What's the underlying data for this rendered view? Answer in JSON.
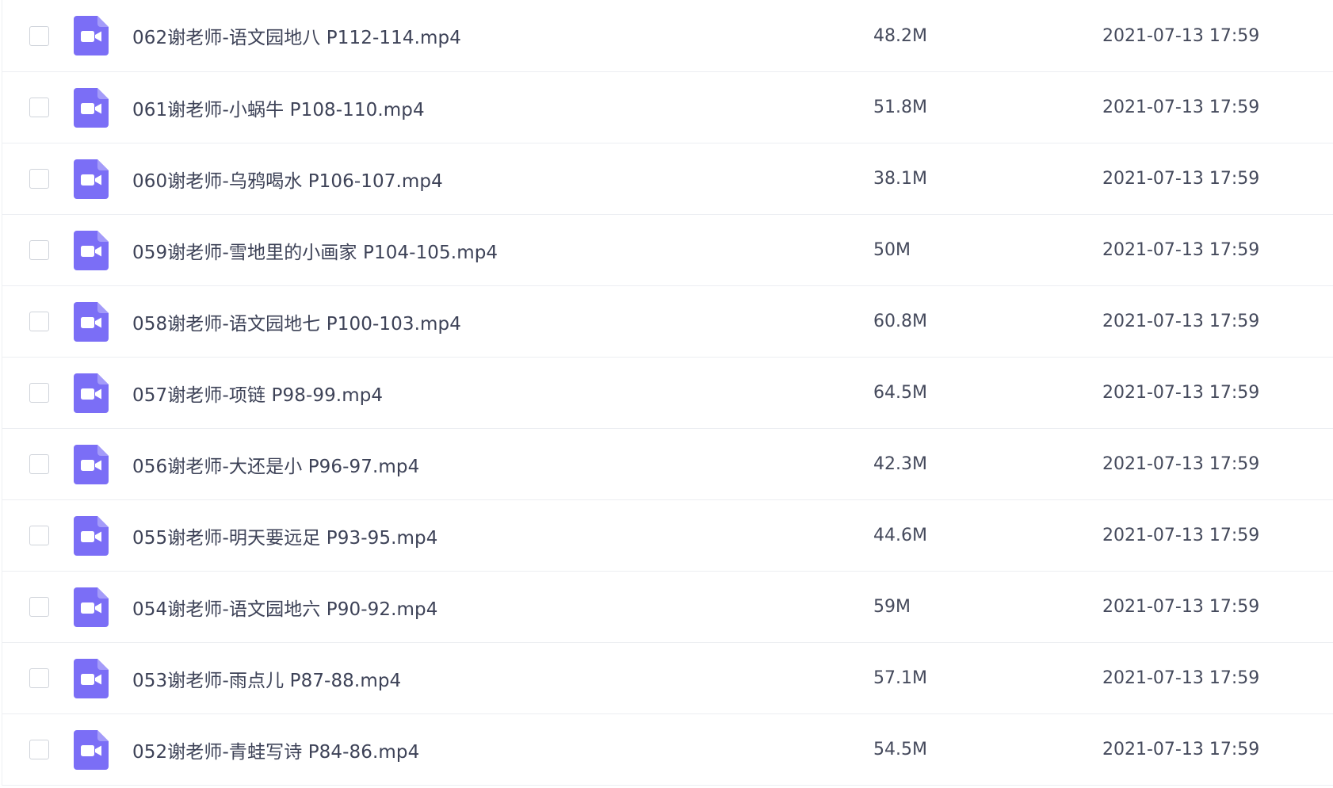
{
  "colors": {
    "icon_bg": "#7b6ef6",
    "row_divider": "#eceef2",
    "text": "#3d4257",
    "checkbox_border": "#cfd3da"
  },
  "file_icon": "video-file-icon",
  "files": [
    {
      "name": "062谢老师-语文园地八 P112-114.mp4",
      "size": "48.2M",
      "date": "2021-07-13 17:59"
    },
    {
      "name": "061谢老师-小蜗牛 P108-110.mp4",
      "size": "51.8M",
      "date": "2021-07-13 17:59"
    },
    {
      "name": "060谢老师-乌鸦喝水 P106-107.mp4",
      "size": "38.1M",
      "date": "2021-07-13 17:59"
    },
    {
      "name": "059谢老师-雪地里的小画家 P104-105.mp4",
      "size": "50M",
      "date": "2021-07-13 17:59"
    },
    {
      "name": "058谢老师-语文园地七 P100-103.mp4",
      "size": "60.8M",
      "date": "2021-07-13 17:59"
    },
    {
      "name": "057谢老师-项链 P98-99.mp4",
      "size": "64.5M",
      "date": "2021-07-13 17:59"
    },
    {
      "name": "056谢老师-大还是小 P96-97.mp4",
      "size": "42.3M",
      "date": "2021-07-13 17:59"
    },
    {
      "name": "055谢老师-明天要远足 P93-95.mp4",
      "size": "44.6M",
      "date": "2021-07-13 17:59"
    },
    {
      "name": "054谢老师-语文园地六 P90-92.mp4",
      "size": "59M",
      "date": "2021-07-13 17:59"
    },
    {
      "name": "053谢老师-雨点儿 P87-88.mp4",
      "size": "57.1M",
      "date": "2021-07-13 17:59"
    },
    {
      "name": "052谢老师-青蛙写诗 P84-86.mp4",
      "size": "54.5M",
      "date": "2021-07-13 17:59"
    }
  ]
}
